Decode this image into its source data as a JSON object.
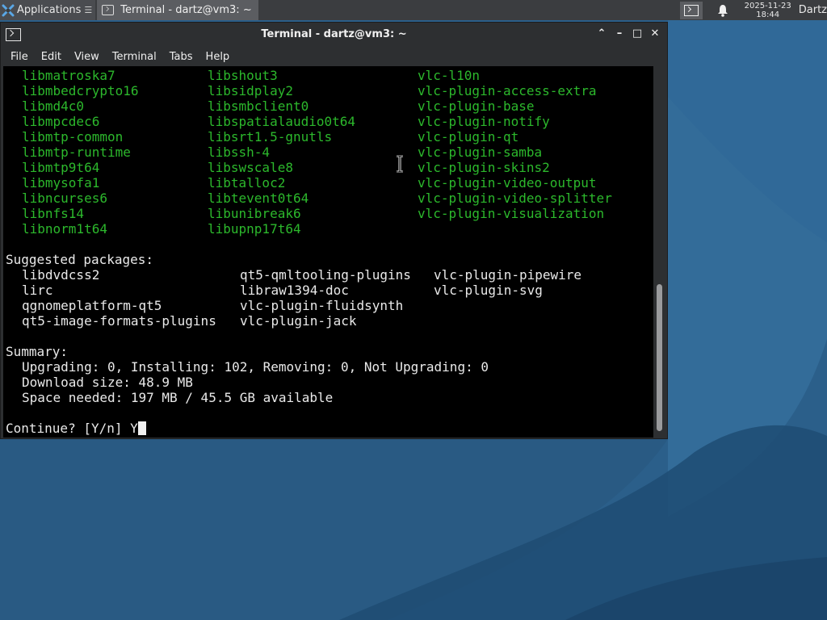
{
  "panel": {
    "applications_label": "Applications",
    "task_title": "Terminal - dartz@vm3: ~",
    "clock_date": "2025-11-23",
    "clock_time": "18:44",
    "user": "Dartz"
  },
  "window": {
    "title": "Terminal - dartz@vm3: ~",
    "menu": [
      "File",
      "Edit",
      "View",
      "Terminal",
      "Tabs",
      "Help"
    ]
  },
  "terminal": {
    "package_columns": [
      [
        "libmatroska7",
        "libmbedcrypto16",
        "libmd4c0",
        "libmpcdec6",
        "libmtp-common",
        "libmtp-runtime",
        "libmtp9t64",
        "libmysofa1",
        "libncurses6",
        "libnfs14",
        "libnorm1t64"
      ],
      [
        "libshout3",
        "libsidplay2",
        "libsmbclient0",
        "libspatialaudio0t64",
        "libsrt1.5-gnutls",
        "libssh-4",
        "libswscale8",
        "libtalloc2",
        "libtevent0t64",
        "libunibreak6",
        "libupnp17t64"
      ],
      [
        "vlc-l10n",
        "vlc-plugin-access-extra",
        "vlc-plugin-base",
        "vlc-plugin-notify",
        "vlc-plugin-qt",
        "vlc-plugin-samba",
        "vlc-plugin-skins2",
        "vlc-plugin-video-output",
        "vlc-plugin-video-splitter",
        "vlc-plugin-visualization"
      ]
    ],
    "suggested_header": "Suggested packages:",
    "suggested_columns": [
      [
        "libdvdcss2",
        "lirc",
        "qgnomeplatform-qt5",
        "qt5-image-formats-plugins"
      ],
      [
        "qt5-qmltooling-plugins",
        "libraw1394-doc",
        "vlc-plugin-fluidsynth",
        "vlc-plugin-jack"
      ],
      [
        "vlc-plugin-pipewire",
        "vlc-plugin-svg"
      ]
    ],
    "summary_header": "Summary:",
    "summary_lines": [
      "Upgrading: 0, Installing: 102, Removing: 0, Not Upgrading: 0",
      "Download size: 48.9 MB",
      "Space needed: 197 MB / 45.5 GB available"
    ],
    "prompt": "Continue? [Y/n] Y"
  },
  "colors": {
    "package_text": "#2cb82c",
    "terminal_bg": "#000000",
    "desktop": "#2a5c86",
    "panel": "#3b3d40"
  }
}
